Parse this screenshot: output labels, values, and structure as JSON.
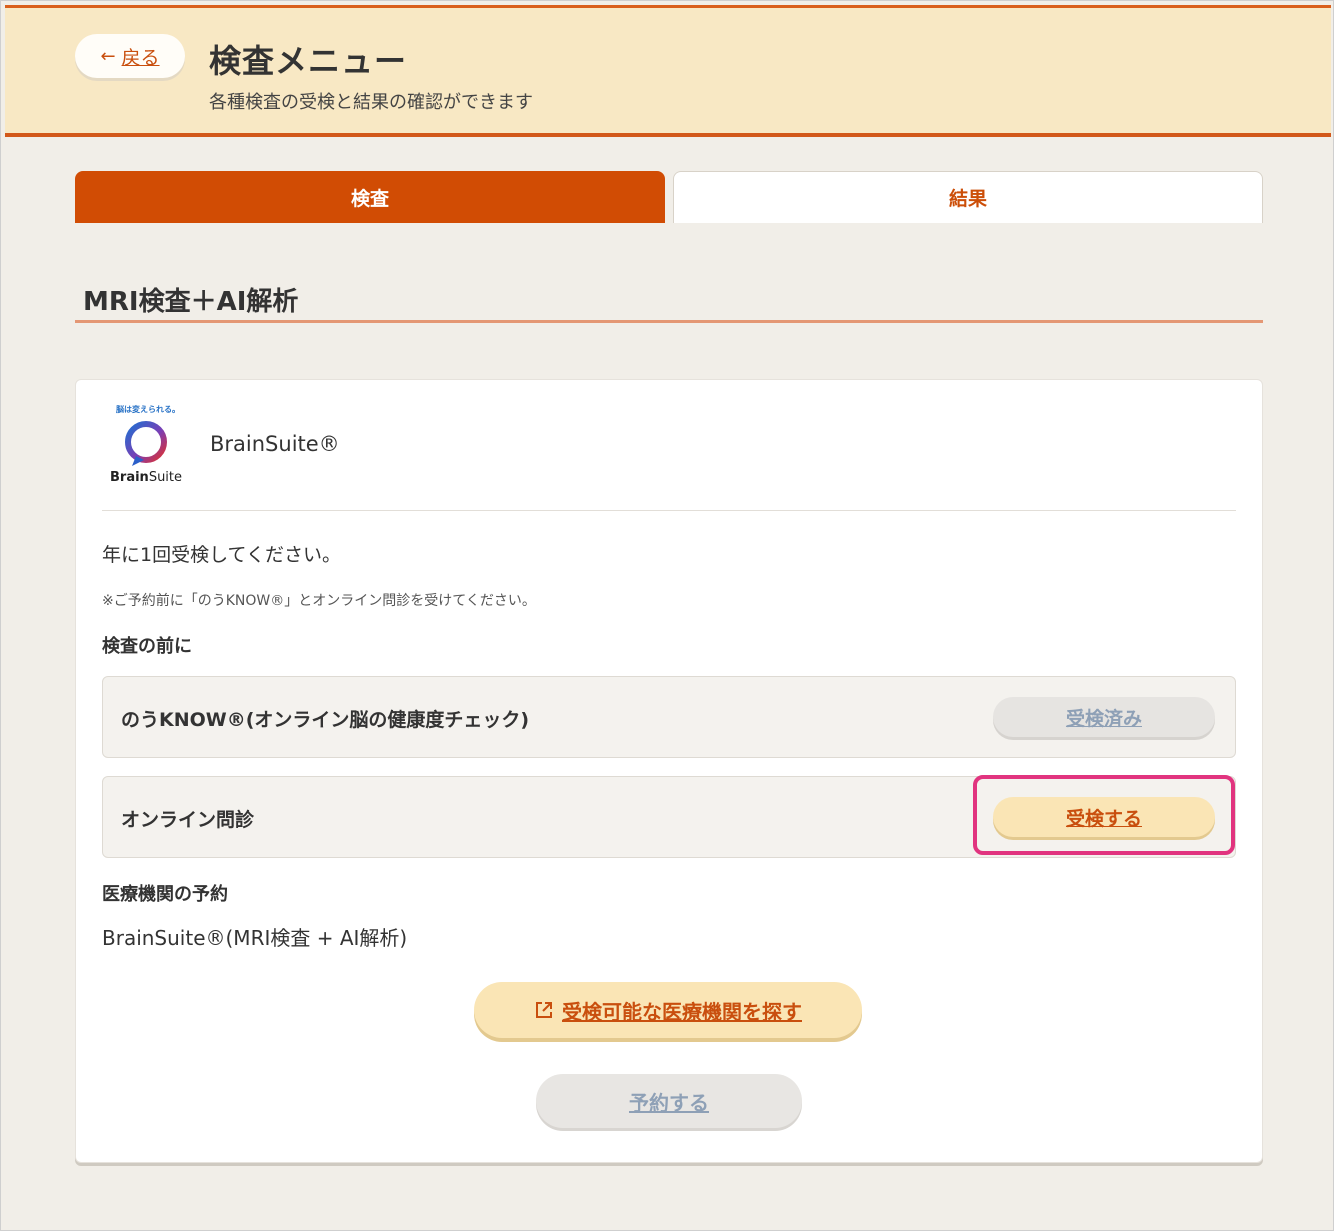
{
  "header": {
    "back_label": "戻る",
    "title": "検査メニュー",
    "subtitle": "各種検査の受検と結果の確認ができます"
  },
  "tabs": [
    {
      "label": "検査",
      "active": true
    },
    {
      "label": "結果",
      "active": false
    }
  ],
  "section": {
    "title": "MRI検査＋AI解析"
  },
  "card": {
    "logo": {
      "tagline": "脳は変えられる。",
      "brand_bold": "Brain",
      "brand_rest": "Suite"
    },
    "product_name": "BrainSuite®",
    "frequency": "年に1回受検してください。",
    "note": "※ご予約前に「のうKNOW®」とオンライン問診を受けてください。",
    "before_heading": "検査の前に",
    "steps": [
      {
        "label": "のうKNOW®(オンライン脳の健康度チェック)",
        "button": "受検済み",
        "status": "done"
      },
      {
        "label": "オンライン問診",
        "button": "受検する",
        "status": "available"
      }
    ],
    "reservation_heading": "医療機関の予約",
    "reservation_item": "BrainSuite®(MRI検査 + AI解析)",
    "find_button": "受検可能な医療機関を探す",
    "reserve_button": "予約する"
  },
  "colors": {
    "accent": "#d14c04",
    "highlight": "#e1347f",
    "header_bg": "#f8e8c4"
  }
}
